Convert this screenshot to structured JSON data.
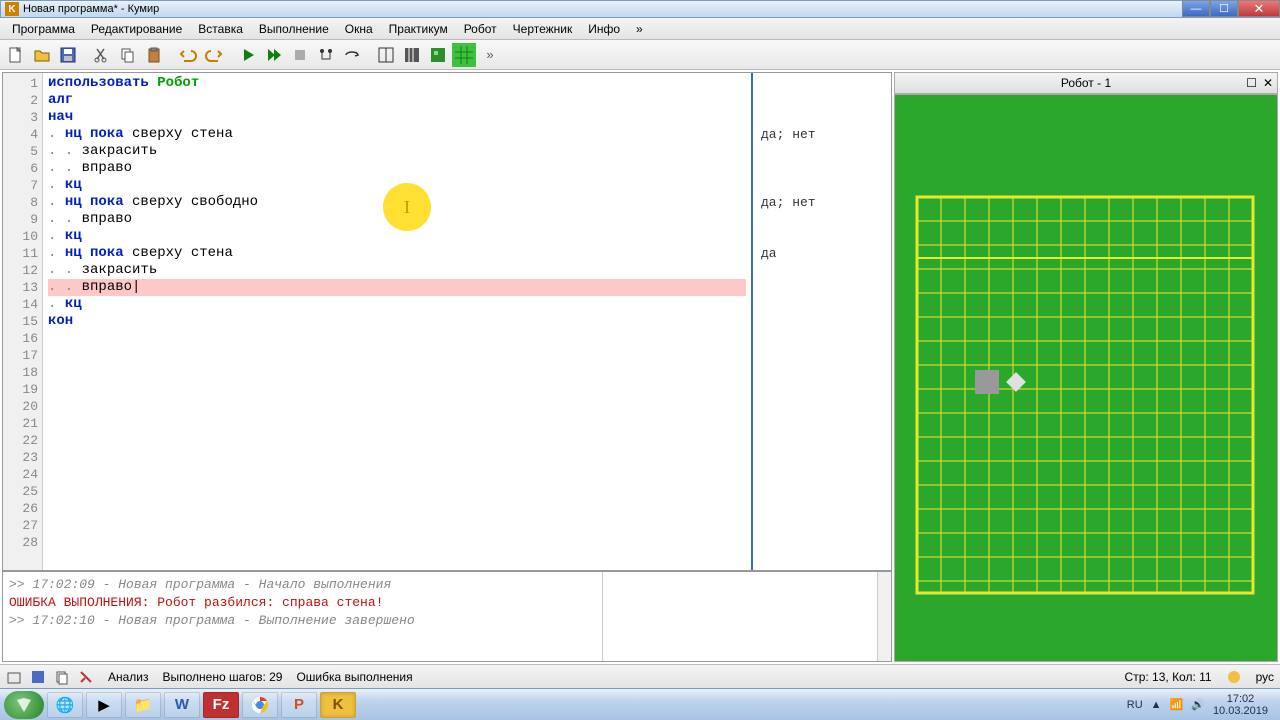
{
  "title": "Новая программа* - Кумир",
  "menu": [
    "Программа",
    "Редактирование",
    "Вставка",
    "Выполнение",
    "Окна",
    "Практикум",
    "Робот",
    "Чертежник",
    "Инфо",
    "»"
  ],
  "code": {
    "lines": [
      {
        "n": 1,
        "segs": [
          {
            "t": "использовать ",
            "c": "kw-blue"
          },
          {
            "t": "Робот",
            "c": "kw-green"
          }
        ]
      },
      {
        "n": 2,
        "segs": [
          {
            "t": "алг",
            "c": "kw-blue"
          }
        ]
      },
      {
        "n": 3,
        "segs": [
          {
            "t": "нач",
            "c": "kw-blue"
          }
        ]
      },
      {
        "n": 4,
        "segs": [
          {
            "t": ". ",
            "c": "dots"
          },
          {
            "t": "нц пока ",
            "c": "kw-blue"
          },
          {
            "t": "сверху стена",
            "c": "kw-norm"
          }
        ],
        "side": "да; нет"
      },
      {
        "n": 5,
        "segs": [
          {
            "t": ". . ",
            "c": "dots"
          },
          {
            "t": "закрасить",
            "c": "kw-norm"
          }
        ]
      },
      {
        "n": 6,
        "segs": [
          {
            "t": ". . ",
            "c": "dots"
          },
          {
            "t": "вправо",
            "c": "kw-norm"
          }
        ]
      },
      {
        "n": 7,
        "segs": [
          {
            "t": ". ",
            "c": "dots"
          },
          {
            "t": "кц",
            "c": "kw-blue"
          }
        ]
      },
      {
        "n": 8,
        "segs": [
          {
            "t": ". ",
            "c": "dots"
          },
          {
            "t": "нц пока ",
            "c": "kw-blue"
          },
          {
            "t": "сверху свободно",
            "c": "kw-norm"
          }
        ],
        "side": "да; нет"
      },
      {
        "n": 9,
        "segs": [
          {
            "t": ". . ",
            "c": "dots"
          },
          {
            "t": "вправо",
            "c": "kw-norm"
          }
        ]
      },
      {
        "n": 10,
        "segs": [
          {
            "t": ". ",
            "c": "dots"
          },
          {
            "t": "кц",
            "c": "kw-blue"
          }
        ]
      },
      {
        "n": 11,
        "segs": [
          {
            "t": ". ",
            "c": "dots"
          },
          {
            "t": "нц пока ",
            "c": "kw-blue"
          },
          {
            "t": "сверху стена",
            "c": "kw-norm"
          }
        ],
        "side": "да"
      },
      {
        "n": 12,
        "segs": [
          {
            "t": ". . ",
            "c": "dots"
          },
          {
            "t": "закрасить",
            "c": "kw-norm"
          }
        ]
      },
      {
        "n": 13,
        "segs": [
          {
            "t": ". . ",
            "c": "dots"
          },
          {
            "t": "вправо",
            "c": "kw-norm"
          }
        ],
        "hl": true,
        "caret": true
      },
      {
        "n": 14,
        "segs": [
          {
            "t": ". ",
            "c": "dots"
          },
          {
            "t": "кц",
            "c": "kw-blue"
          }
        ]
      },
      {
        "n": 15,
        "segs": [
          {
            "t": "кон",
            "c": "kw-blue"
          }
        ]
      },
      {
        "n": 16,
        "segs": []
      },
      {
        "n": 17,
        "segs": []
      },
      {
        "n": 18,
        "segs": []
      },
      {
        "n": 19,
        "segs": []
      },
      {
        "n": 20,
        "segs": []
      },
      {
        "n": 21,
        "segs": []
      },
      {
        "n": 22,
        "segs": []
      },
      {
        "n": 23,
        "segs": []
      },
      {
        "n": 24,
        "segs": []
      },
      {
        "n": 25,
        "segs": []
      },
      {
        "n": 26,
        "segs": []
      },
      {
        "n": 27,
        "segs": []
      },
      {
        "n": 28,
        "segs": []
      }
    ]
  },
  "console": [
    {
      "t": ">> 17:02:09 - Новая программа - Начало выполнения",
      "c": "con-gray"
    },
    {
      "t": "ОШИБКА ВЫПОЛНЕНИЯ: Робот разбился: справа стена!",
      "c": "con-red"
    },
    {
      "t": ">> 17:02:10 - Новая программа - Выполнение завершено",
      "c": "con-gray"
    }
  ],
  "robot": {
    "title": "Робот - 1"
  },
  "status": {
    "analysis": "Анализ",
    "steps": "Выполнено шагов: 29",
    "error": "Ошибка выполнения",
    "pos": "Стр: 13, Кол: 11",
    "lang": "рус"
  },
  "tray": {
    "lang": "RU",
    "time": "17:02",
    "date": "10.03.2019"
  }
}
